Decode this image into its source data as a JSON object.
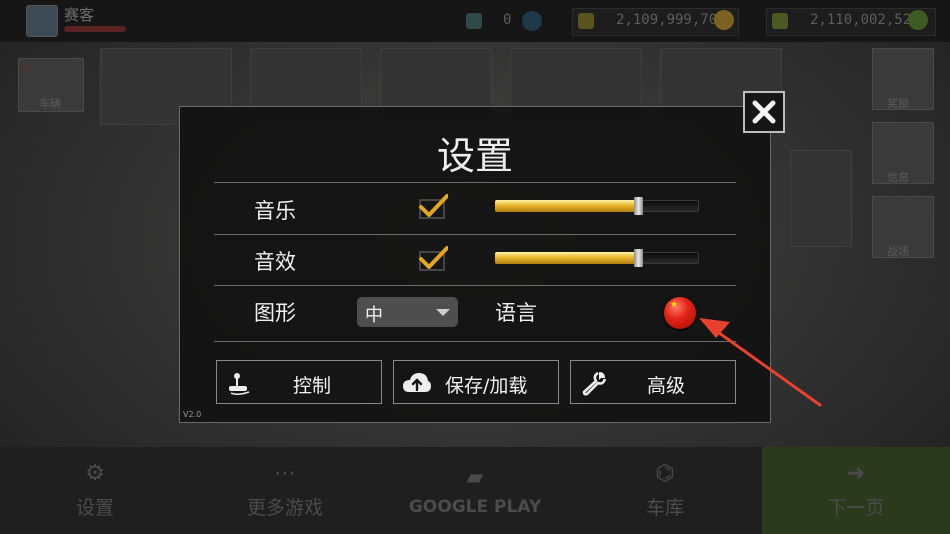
{
  "header": {
    "player_name": "赛客",
    "stat_value": "0",
    "currency_1": "2,109,999,701",
    "currency_2": "2,110,002,527"
  },
  "side_menu": {
    "left_label": "车辆",
    "left_count": "3",
    "right_items": [
      "奖励",
      "信息",
      "战场"
    ]
  },
  "dialog": {
    "title": "设置",
    "music_label": "音乐",
    "music_enabled": true,
    "music_volume": 0.7,
    "sfx_label": "音效",
    "sfx_enabled": true,
    "sfx_volume": 0.7,
    "graphics_label": "图形",
    "graphics_value": "中",
    "language_label": "语言",
    "language_flag": "china-flag",
    "buttons": {
      "controls": "控制",
      "save_load": "保存/加载",
      "advanced": "高级"
    },
    "version": "V2.0"
  },
  "bottom_nav": {
    "items": [
      "设置",
      "更多游戏",
      "GOOGLE PLAY",
      "车库",
      "下一页"
    ]
  },
  "colors": {
    "slider_fill": "#e8b82a",
    "checkmark": "#e3a71b",
    "annotation_arrow": "#e8412e"
  }
}
